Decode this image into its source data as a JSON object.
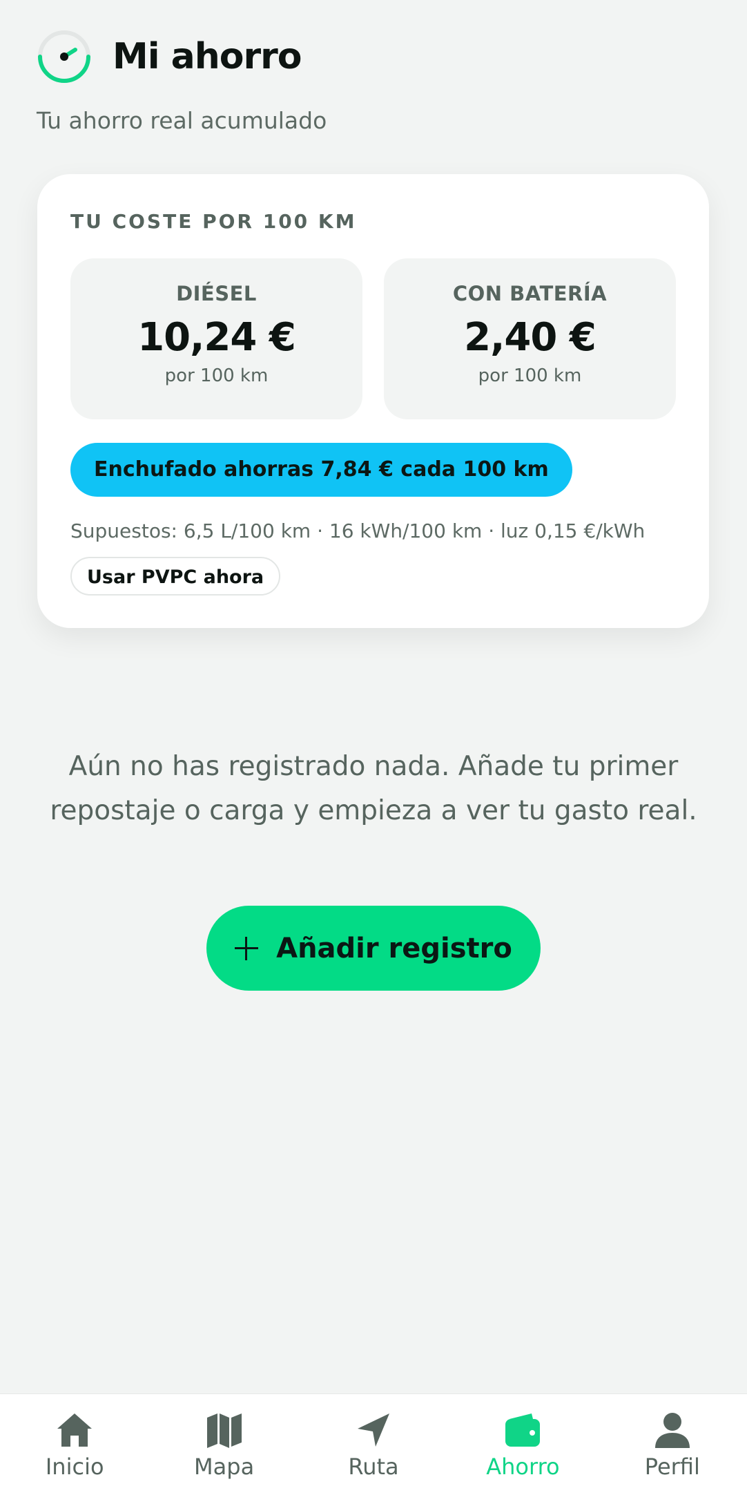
{
  "header": {
    "title": "Mi ahorro",
    "subtitle": "Tu ahorro real acumulado",
    "logo_icon": "gauge-icon"
  },
  "cost_card": {
    "label": "TU COSTE POR 100 KM",
    "diesel": {
      "name": "DIÉSEL",
      "value": "10,24 €",
      "unit": "por 100 km"
    },
    "battery": {
      "name": "CON BATERÍA",
      "value": "2,40 €",
      "unit": "por 100 km"
    },
    "savings": "Enchufado ahorras 7,84 € cada 100 km",
    "assumptions": "Supuestos: 6,5 L/100 km · 16 kWh/100 km · luz 0,15 €/kWh",
    "pvpc_button": "Usar PVPC ahora"
  },
  "empty_state": {
    "message": "Aún no has registrado nada. Añade tu primer repostaje o carga y empieza a ver tu gasto real.",
    "add_button": "Añadir registro"
  },
  "tabbar": {
    "items": [
      {
        "label": "Inicio",
        "icon": "home-icon",
        "active": false
      },
      {
        "label": "Mapa",
        "icon": "map-icon",
        "active": false
      },
      {
        "label": "Ruta",
        "icon": "navigation-arrow-icon",
        "active": false
      },
      {
        "label": "Ahorro",
        "icon": "wallet-icon",
        "active": true
      },
      {
        "label": "Perfil",
        "icon": "person-icon",
        "active": false
      }
    ]
  },
  "colors": {
    "accent_green": "#03db86",
    "accent_blue": "#10c3f5",
    "active_tab": "#10d487",
    "background": "#f2f4f3"
  }
}
